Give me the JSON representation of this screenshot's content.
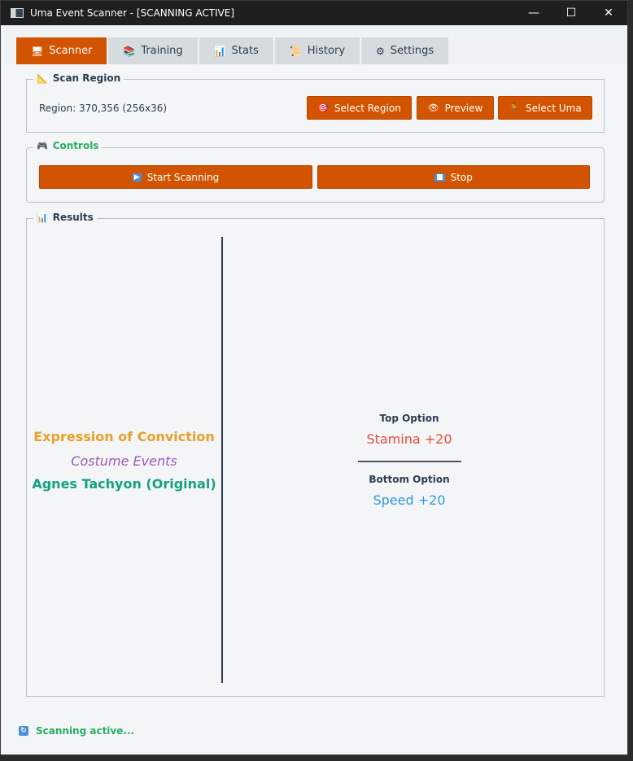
{
  "window": {
    "title": "Uma Event Scanner - [SCANNING ACTIVE]",
    "minimize": "—",
    "maximize": "☐",
    "close": "✕"
  },
  "tabs": [
    {
      "label": "Scanner",
      "icon": "monitor-icon",
      "glyph": "🖥"
    },
    {
      "label": "Training",
      "icon": "books-icon",
      "glyph": "📚"
    },
    {
      "label": "Stats",
      "icon": "bar-chart-icon",
      "glyph": "📊"
    },
    {
      "label": "History",
      "icon": "scroll-icon",
      "glyph": "📜"
    },
    {
      "label": "Settings",
      "icon": "gear-icon",
      "glyph": "⚙"
    }
  ],
  "scan_region": {
    "legend": "Scan Region",
    "legend_glyph": "📐",
    "region_text": "Region: 370,356 (256x36)",
    "select_region": "Select Region",
    "select_region_glyph": "🎯",
    "preview": "Preview",
    "preview_glyph": "👁",
    "select_uma": "Select Uma",
    "select_uma_glyph": "🏃"
  },
  "controls": {
    "legend": "Controls",
    "legend_glyph": "🎮",
    "start": "Start Scanning",
    "start_glyph": "▶",
    "stop": "Stop",
    "stop_glyph": "■"
  },
  "results": {
    "legend": "Results",
    "legend_glyph": "📊",
    "event_title": "Expression of Conviction",
    "event_category": "Costume Events",
    "character": "Agnes Tachyon (Original)",
    "top_option_label": "Top Option",
    "top_option_value": "Stamina +20",
    "bottom_option_label": "Bottom Option",
    "bottom_option_value": "Speed +20"
  },
  "status": {
    "text": "Scanning active...",
    "glyph": "↻"
  },
  "colors": {
    "accent": "#d35400",
    "success": "#27ae60",
    "event_title": "#e8a02a",
    "category": "#9b59b6",
    "character": "#16a085",
    "stamina": "#e74c3c",
    "speed": "#3498db"
  }
}
